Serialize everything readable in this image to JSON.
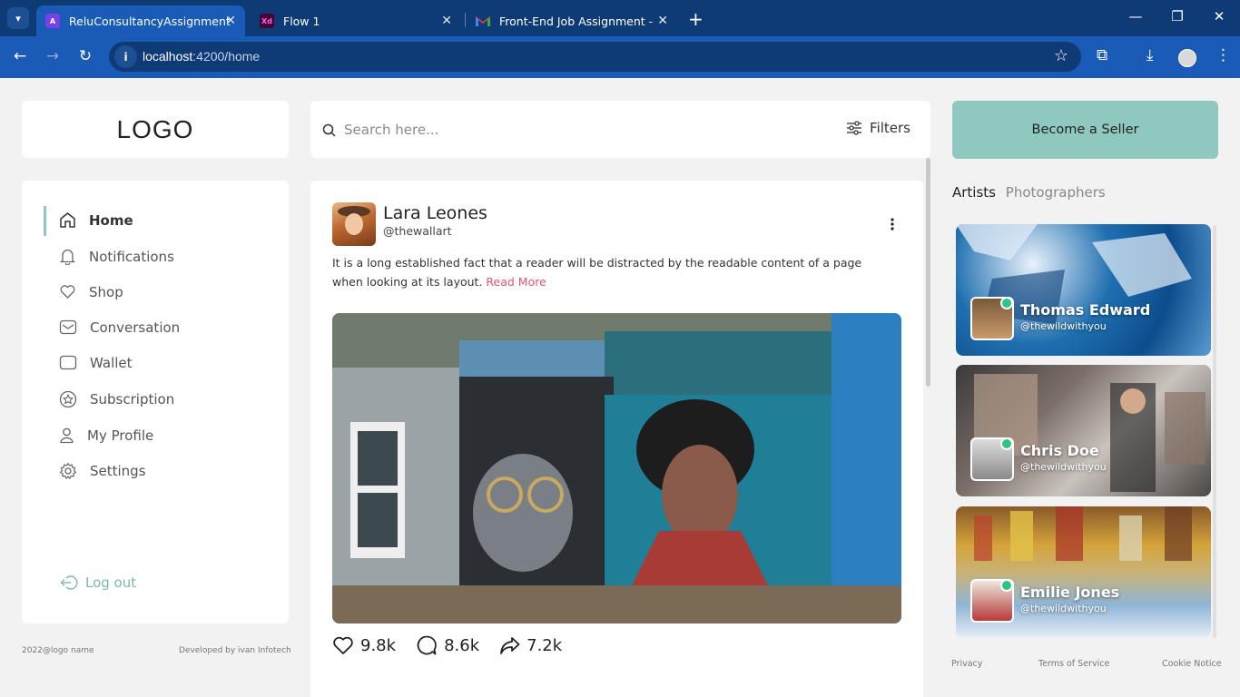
{
  "browser": {
    "tabs": [
      {
        "title": "ReluConsultancyAssignment",
        "active": true,
        "favicon": "angular-icon"
      },
      {
        "title": "Flow 1",
        "active": false,
        "favicon": "xd-icon"
      },
      {
        "title": "Front-End Job Assignment - Rel",
        "active": false,
        "favicon": "gmail-icon"
      }
    ],
    "url_host": "localhost",
    "url_path": ":4200/home"
  },
  "logo": "LOGO",
  "search": {
    "placeholder": "Search here...",
    "filters_label": "Filters"
  },
  "seller_button": "Become a Seller",
  "sidebar": {
    "items": [
      {
        "label": "Home",
        "icon": "home-icon"
      },
      {
        "label": "Notifications",
        "icon": "bell-icon"
      },
      {
        "label": "Shop",
        "icon": "heart-icon"
      },
      {
        "label": "Conversation",
        "icon": "mail-icon"
      },
      {
        "label": "Wallet",
        "icon": "wallet-icon"
      },
      {
        "label": "Subscription",
        "icon": "star-icon"
      },
      {
        "label": "My Profile",
        "icon": "user-icon"
      },
      {
        "label": "Settings",
        "icon": "gear-icon"
      }
    ],
    "logout": "Log out"
  },
  "footer": {
    "copyright": "2022@logo name",
    "developer": "Developed by ivan Infotech"
  },
  "post": {
    "name": "Lara Leones",
    "handle": "@thewallart",
    "text": "It is a long established fact that a reader will be distracted by the readable content of a page when looking at its layout.",
    "read_more": "Read More",
    "likes": "9.8k",
    "comments": "8.6k",
    "shares": "7.2k"
  },
  "right": {
    "tabs": [
      "Artists",
      "Photographers"
    ],
    "artists": [
      {
        "name": "Thomas Edward",
        "handle": "@thewildwithyou"
      },
      {
        "name": "Chris Doe",
        "handle": "@thewildwithyou"
      },
      {
        "name": "Emilie Jones",
        "handle": "@thewildwithyou"
      }
    ],
    "footer_links": [
      "Privacy",
      "Terms of Service",
      "Cookie Notice"
    ]
  },
  "colors": {
    "accent": "#8ec8bf",
    "read_more": "#e0566a",
    "online": "#2bc48a",
    "chrome": "#1a5bb8"
  }
}
